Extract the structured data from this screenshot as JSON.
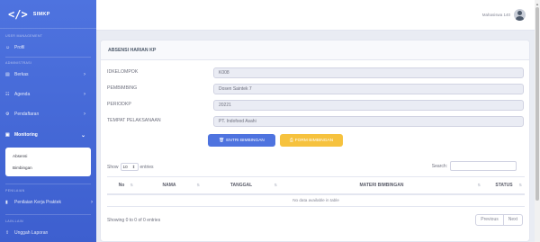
{
  "brand": {
    "logo": "</>",
    "name": "SIMKP"
  },
  "sidebar": {
    "heading_user": "USER MANAGEMENT",
    "profil": "Profil",
    "heading_admin": "ADMINISTRASI",
    "berkas": "Berkas",
    "agenda": "Agenda",
    "pendaftaran": "Pendaftaran",
    "monitoring": "Monitoring",
    "sub_absensi": "Absensi",
    "sub_bimbingan": "Bimbingan",
    "heading_penilaian": "PENILAIAN",
    "penilaian": "Penilaian Kerja Praktek",
    "heading_lain": "LAIN-LAIN",
    "unggah": "Unggah Laporan"
  },
  "topbar": {
    "user_name": "Mahasiswa 140"
  },
  "card": {
    "title": "ABSENSI HARIAN KP",
    "fields": [
      {
        "label": "IDKELOMPOK",
        "value": "K008"
      },
      {
        "label": "PEMBIMBING",
        "value": "Dosen Saintek 7"
      },
      {
        "label": "PERIODKP",
        "value": "20221"
      },
      {
        "label": "TEMPAT PELAKSANAAN",
        "value": "PT. Indofood Asahi"
      }
    ],
    "btn_entri": "ENTRI BIMBINGAN",
    "btn_form": "FORM BIMBINGAN"
  },
  "table": {
    "show": "Show",
    "entries_value": "10",
    "entries": "entries",
    "search_label": "Search:",
    "columns": [
      "No",
      "NAMA",
      "TANGGAL",
      "MATERI BIMBINGAN",
      "STATUS"
    ],
    "empty": "No data available in table",
    "info": "Showing 0 to 0 of 0 entries",
    "prev": "Previous",
    "next": "Next"
  },
  "colors": {
    "primary": "#4e73df",
    "warning": "#f6c23e"
  }
}
